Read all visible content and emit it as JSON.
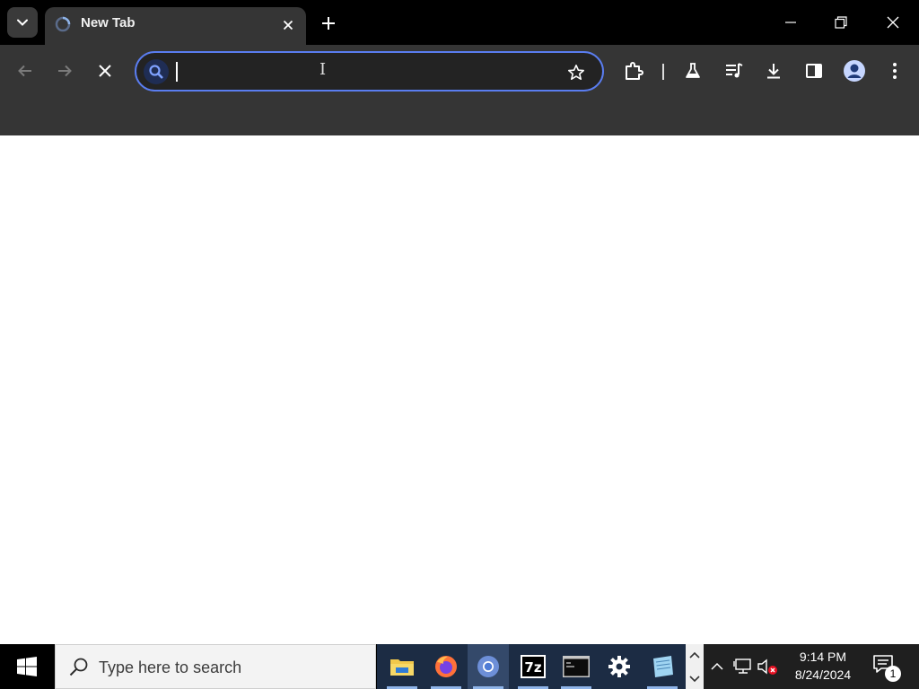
{
  "browser": {
    "tab": {
      "title": "New Tab"
    },
    "omnibox": {
      "value": "",
      "placeholder": ""
    }
  },
  "taskbar": {
    "search": {
      "placeholder": "Type here to search"
    },
    "apps": [
      "file-explorer",
      "firefox",
      "chrome",
      "7-zip",
      "command-prompt",
      "settings",
      "notepad"
    ],
    "clock": {
      "time": "9:14 PM",
      "date": "8/24/2024"
    },
    "notifications": {
      "count": "1"
    }
  },
  "colors": {
    "accent": "#5a7df0",
    "tab_bg": "#353535",
    "taskbar_bg": "#000000"
  }
}
